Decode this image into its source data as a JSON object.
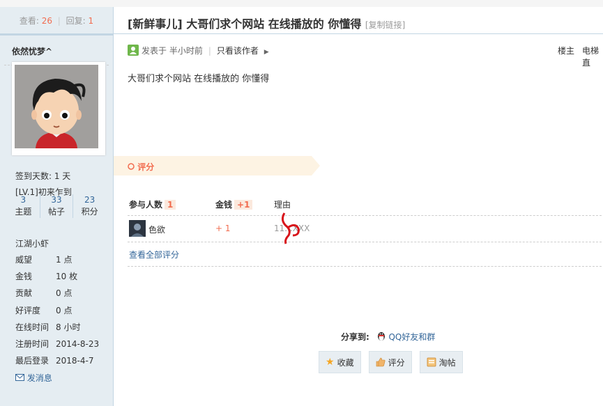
{
  "header": {
    "views_label": "查看:",
    "views": "26",
    "replies_label": "回复:",
    "replies": "1",
    "title": "[新鲜事儿] 大哥们求个网站 在线播放的 你懂得",
    "copy_link": "[复制链接]"
  },
  "author": {
    "name": "依然忧梦^",
    "sign_days": "签到天数: 1 天",
    "level": "[LV.1]初来乍到",
    "counts": [
      {
        "value": "3",
        "label": "主题"
      },
      {
        "value": "33",
        "label": "帖子"
      },
      {
        "value": "23",
        "label": "积分"
      }
    ],
    "rank": "江湖小虾",
    "details": [
      {
        "key": "威望",
        "value": "1 点"
      },
      {
        "key": "金钱",
        "value": "10 枚"
      },
      {
        "key": "贡献",
        "value": "0 点"
      },
      {
        "key": "好评度",
        "value": "0 点"
      },
      {
        "key": "在线时间",
        "value": "8 小时"
      },
      {
        "key": "注册时间",
        "value": "2014-8-23"
      },
      {
        "key": "最后登录",
        "value": "2018-4-7"
      }
    ],
    "send_message": "发消息"
  },
  "post": {
    "posted_at": "发表于 半小时前",
    "only_author": "只看该作者",
    "floor": "楼主",
    "elevator": "电梯直",
    "content": "大哥们求个网站  在线播放的   你懂得"
  },
  "rating": {
    "title": "评分",
    "col_participants": "参与人数",
    "participants": "1",
    "col_money": "金钱",
    "money_total": "+1",
    "col_reason": "理由",
    "rows": [
      {
        "user": "色欲",
        "money": "+ 1",
        "reason": "11...XXX"
      }
    ],
    "view_all": "查看全部评分"
  },
  "share": {
    "label": "分享到:",
    "qq": "QQ好友和群"
  },
  "actions": {
    "favorite": "收藏",
    "rate": "评分",
    "taotie": "淘帖"
  },
  "colors": {
    "accent": "#f26c4f",
    "link": "#336699",
    "sidebar": "#e5edf2"
  }
}
